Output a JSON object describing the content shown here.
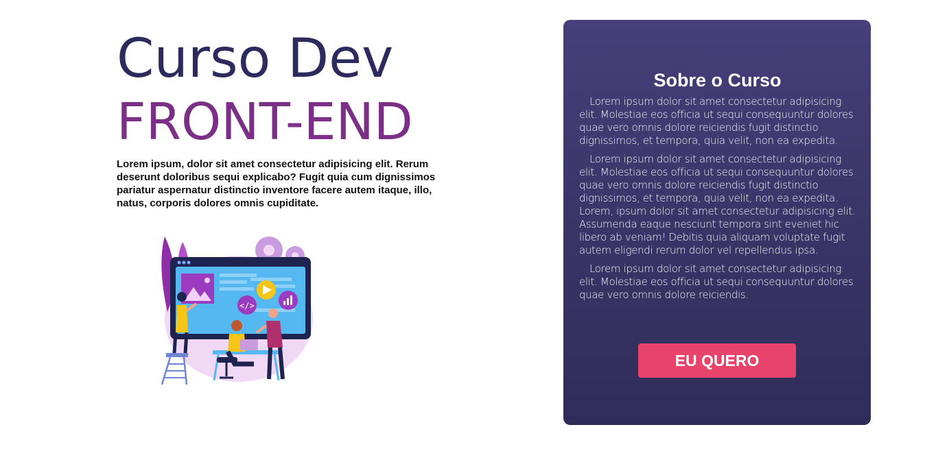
{
  "hero": {
    "title_line1": "Curso Dev",
    "title_line2": "FRONT-END",
    "intro": "Lorem ipsum, dolor sit amet consectetur adipisicing elit. Rerum deserunt doloribus sequi explicabo? Fugit quia cum dignissimos pariatur aspernatur distinctio inventore facere autem itaque, illo, natus, corporis dolores omnis cupiditate.",
    "illustration_icon": "developers-illustration"
  },
  "about": {
    "title": "Sobre o Curso",
    "paragraphs": [
      "Lorem ipsum dolor sit amet consectetur adipisicing elit. Molestiae eos officia ut sequi consequuntur dolores quae vero omnis dolore reiciendis fugit distinctio dignissimos, et tempora, quia velit, non ea expedita.",
      "Lorem ipsum dolor sit amet consectetur adipisicing elit. Molestiae eos officia ut sequi consequuntur dolores quae vero omnis dolore reiciendis fugit distinctio dignissimos, et tempora, quia velit, non ea expedita. Lorem, ipsum dolor sit amet consectetur adipisicing elit. Assumenda eaque nesciunt tempora sint eveniet hic libero ab veniam! Debitis quia aliquam voluptate fugit autem eligendi rerum dolor vel repellendus ipsa.",
      "Lorem ipsum dolor sit amet consectetur adipisicing elit. Molestiae eos officia ut sequi consequuntur dolores quae vero omnis dolore reiciendis."
    ],
    "cta_label": "EU QUERO"
  },
  "colors": {
    "title_dark": "#2d2b5e",
    "title_accent": "#7b2f86",
    "card_bg": "#3a3567",
    "cta": "#e8446b"
  }
}
